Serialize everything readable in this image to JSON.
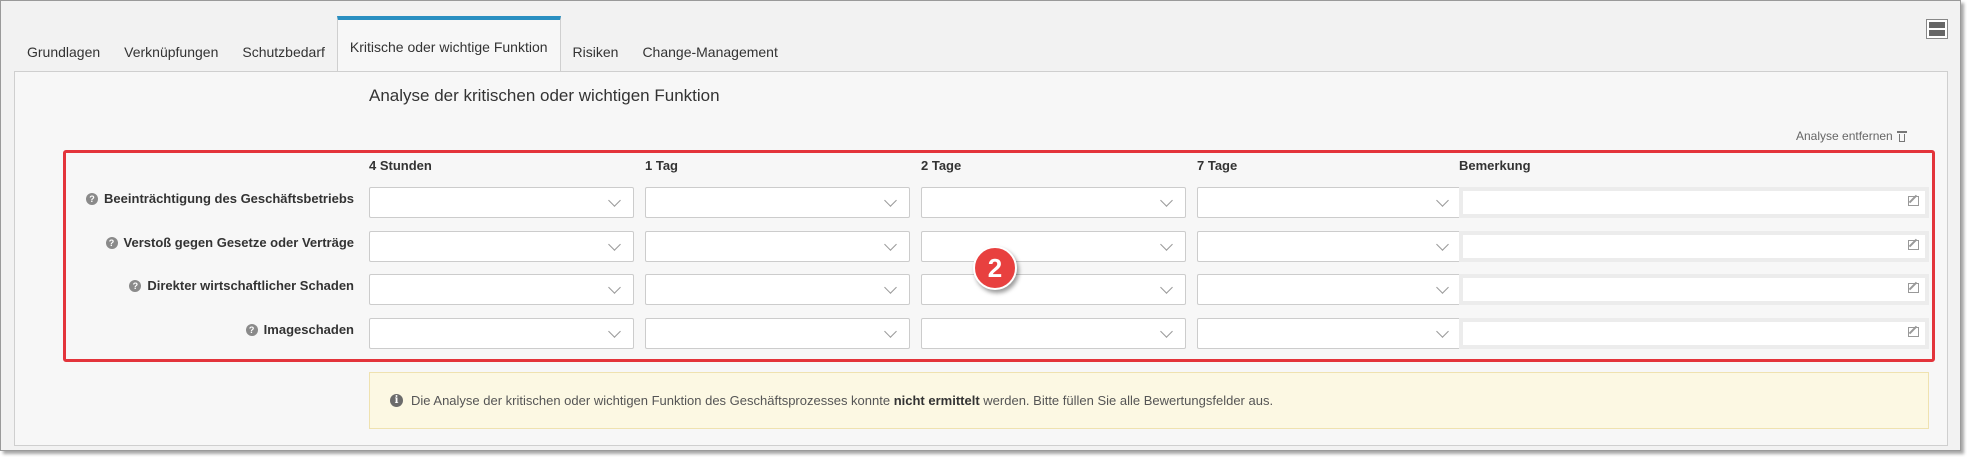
{
  "tabs": [
    {
      "label": "Grundlagen",
      "active": false
    },
    {
      "label": "Verknüpfungen",
      "active": false
    },
    {
      "label": "Schutzbedarf",
      "active": false
    },
    {
      "label": "Kritische oder wichtige Funktion",
      "active": true
    },
    {
      "label": "Risiken",
      "active": false
    },
    {
      "label": "Change-Management",
      "active": false
    }
  ],
  "section": {
    "title": "Analyse der kritischen oder wichtigen Funktion",
    "remove_label": "Analyse entfernen"
  },
  "columns": [
    "4 Stunden",
    "1 Tag",
    "2 Tage",
    "7 Tage",
    "Bemerkung"
  ],
  "rows": [
    {
      "label": "Beeinträchtigung des Geschäftsbetriebs"
    },
    {
      "label": "Verstoß gegen Gesetze oder Verträge"
    },
    {
      "label": "Direkter wirtschaftlicher Schaden"
    },
    {
      "label": "Imageschaden"
    }
  ],
  "badge": "2",
  "notice": {
    "pre": "Die Analyse der kritischen oder wichtigen Funktion des Geschäftsprozesses konnte ",
    "bold": "nicht ermittelt",
    "post": " werden. Bitte füllen Sie alle Bewertungsfelder aus."
  },
  "colors": {
    "accent": "#2a8fc1",
    "highlight": "#e3343b",
    "notice_bg": "#fcf8e3"
  }
}
